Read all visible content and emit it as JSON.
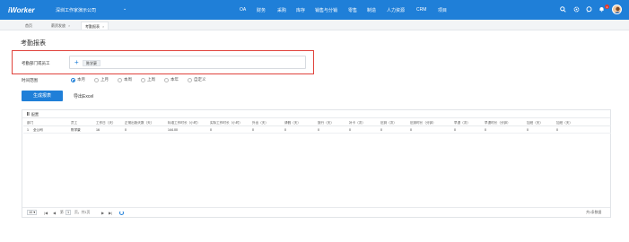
{
  "app": {
    "logo": "iWorker",
    "company": "深圳工作家演示公司",
    "company_caret": "⌄",
    "nav": [
      "OA",
      "财务",
      "采购",
      "库存",
      "销售与分销",
      "零售",
      "制造",
      "人力资源",
      "CRM",
      "项目"
    ],
    "icons": [
      "search-icon",
      "settings-icon",
      "chat-icon",
      "notification-icon"
    ],
    "notification_count": "1"
  },
  "tabs": [
    {
      "label": "首页",
      "closable": false
    },
    {
      "label": "薪资发放",
      "closable": true
    },
    {
      "label": "考勤报表",
      "closable": true
    }
  ],
  "page": {
    "title": "考勤报表",
    "field_label": "考勤部门或员工",
    "picker_plus": "+",
    "selected_chip": "陈学豪",
    "range_label": "时间范围",
    "range_options": [
      "本月",
      "上月",
      "本周",
      "上周",
      "本年",
      "自定义"
    ],
    "range_selected": "本月",
    "generate_button": "生成报表",
    "export_button": "导出Excel"
  },
  "table": {
    "panel_title": "配置",
    "columns": [
      "部门",
      "员工",
      "工作日（天）",
      "正常出勤天数（天）",
      "标准工作时长（小时）",
      "实际工作时长（小时）",
      "外出（天）",
      "请假（天）",
      "旅行（天）",
      "补卡（次）",
      "迟到（次）",
      "迟到时长（分钟）",
      "早退（次）",
      "早退时长（分钟）",
      "加班（天）",
      "加班（天）"
    ],
    "rows": [
      {
        "index": "1",
        "cells": [
          "全公司",
          "陈学豪",
          "16",
          "0",
          "144.00",
          "0",
          "0",
          "0",
          "0",
          "0",
          "0",
          "0",
          "0",
          "0",
          "0",
          "0"
        ]
      }
    ]
  },
  "pager": {
    "page_size": "10 ▾",
    "first": "|◀",
    "prev": "◀",
    "page_prefix": "第",
    "page_number": "1",
    "page_suffix": "页，共1页",
    "next": "▶",
    "last": "▶|",
    "summary": "共1条数据"
  },
  "colors": {
    "brand_blue": "#1f7fd8",
    "highlight_red": "#e0433c"
  }
}
